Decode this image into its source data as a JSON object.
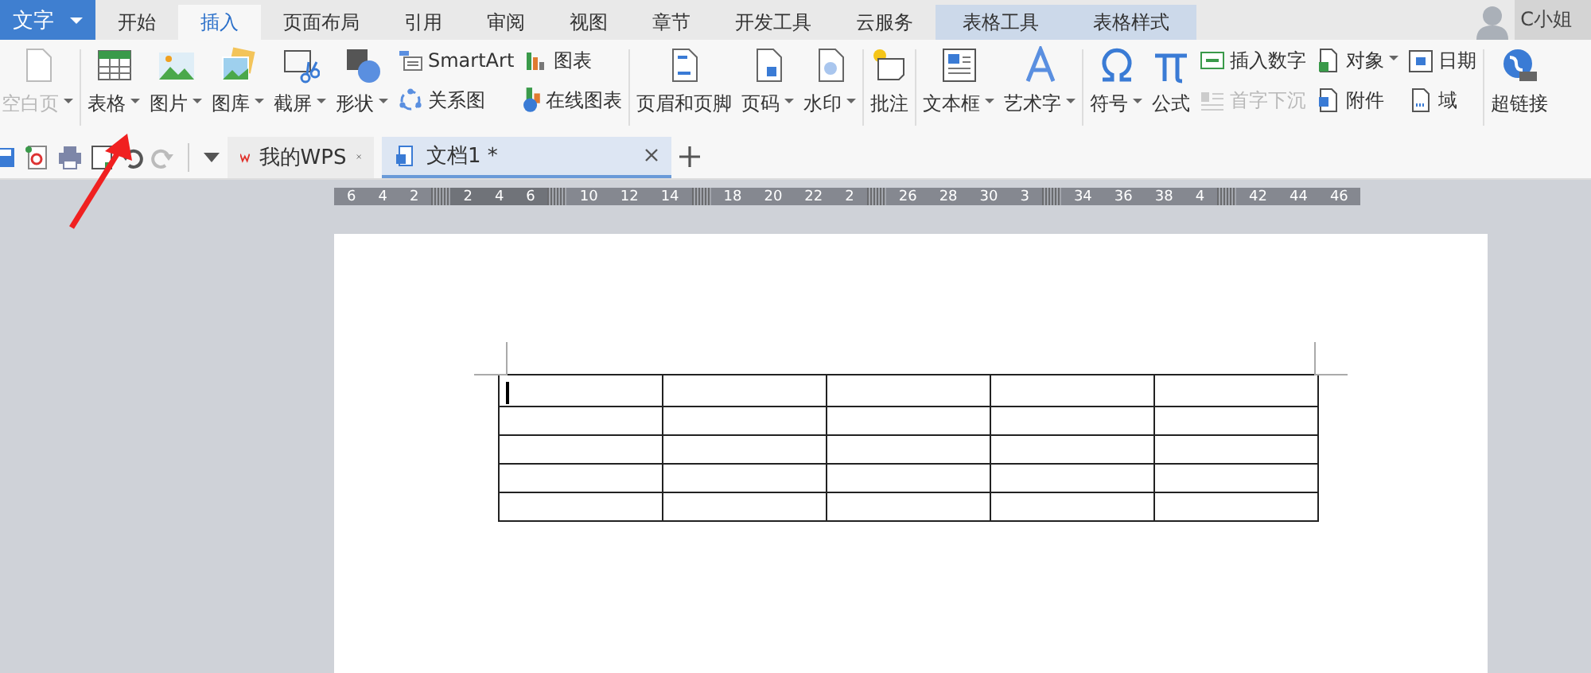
{
  "app_button": {
    "label": "文字"
  },
  "tabs": [
    {
      "label": "开始",
      "selected": false,
      "contextual": false
    },
    {
      "label": "插入",
      "selected": true,
      "contextual": false
    },
    {
      "label": "页面布局",
      "selected": false,
      "contextual": false
    },
    {
      "label": "引用",
      "selected": false,
      "contextual": false
    },
    {
      "label": "审阅",
      "selected": false,
      "contextual": false
    },
    {
      "label": "视图",
      "selected": false,
      "contextual": false
    },
    {
      "label": "章节",
      "selected": false,
      "contextual": false
    },
    {
      "label": "开发工具",
      "selected": false,
      "contextual": false
    },
    {
      "label": "云服务",
      "selected": false,
      "contextual": false
    },
    {
      "label": "表格工具",
      "selected": false,
      "contextual": true
    },
    {
      "label": "表格样式",
      "selected": false,
      "contextual": true
    }
  ],
  "user": {
    "name": "C小姐"
  },
  "ribbon_groups": [
    {
      "items": [
        {
          "kind": "large",
          "label": "空白页",
          "dropdown": true,
          "disabled": true
        }
      ]
    },
    {
      "items": [
        {
          "kind": "large",
          "label": "表格",
          "dropdown": true,
          "disabled": false
        },
        {
          "kind": "large",
          "label": "图片",
          "dropdown": true,
          "disabled": false
        },
        {
          "kind": "large",
          "label": "图库",
          "dropdown": true,
          "disabled": false
        },
        {
          "kind": "large",
          "label": "截屏",
          "dropdown": true,
          "disabled": false
        },
        {
          "kind": "large",
          "label": "形状",
          "dropdown": true,
          "disabled": false
        },
        {
          "kind": "stack",
          "entries": [
            {
              "label": "SmartArt",
              "dropdown": false,
              "disabled": false
            },
            {
              "label": "关系图",
              "dropdown": false,
              "disabled": false
            }
          ]
        },
        {
          "kind": "stack",
          "entries": [
            {
              "label": "图表",
              "dropdown": false,
              "disabled": false
            },
            {
              "label": "在线图表",
              "dropdown": false,
              "disabled": false
            }
          ]
        }
      ]
    },
    {
      "items": [
        {
          "kind": "large",
          "label": "页眉和页脚",
          "dropdown": false,
          "disabled": false
        },
        {
          "kind": "large",
          "label": "页码",
          "dropdown": true,
          "disabled": false
        },
        {
          "kind": "large",
          "label": "水印",
          "dropdown": true,
          "disabled": false
        }
      ]
    },
    {
      "items": [
        {
          "kind": "large",
          "label": "批注",
          "dropdown": false,
          "disabled": false
        }
      ]
    },
    {
      "items": [
        {
          "kind": "large",
          "label": "文本框",
          "dropdown": true,
          "disabled": false
        },
        {
          "kind": "large",
          "label": "艺术字",
          "dropdown": true,
          "disabled": false
        }
      ]
    },
    {
      "items": [
        {
          "kind": "large",
          "label": "符号",
          "dropdown": true,
          "disabled": false
        },
        {
          "kind": "large",
          "label": "公式",
          "dropdown": false,
          "disabled": false
        },
        {
          "kind": "stack",
          "entries": [
            {
              "label": "插入数字",
              "dropdown": false,
              "disabled": false
            },
            {
              "label": "首字下沉",
              "dropdown": false,
              "disabled": true
            }
          ]
        },
        {
          "kind": "stack",
          "entries": [
            {
              "label": "对象",
              "dropdown": true,
              "disabled": false
            },
            {
              "label": "附件",
              "dropdown": false,
              "disabled": false
            }
          ]
        },
        {
          "kind": "stack",
          "entries": [
            {
              "label": "日期",
              "dropdown": false,
              "disabled": false
            },
            {
              "label": "域",
              "dropdown": false,
              "disabled": false
            }
          ]
        }
      ]
    },
    {
      "items": [
        {
          "kind": "large",
          "label": "超链接",
          "dropdown": false,
          "disabled": false
        }
      ]
    }
  ],
  "doc_tabs": [
    {
      "label": "我的WPS",
      "selected": false
    },
    {
      "label": "文档1 *",
      "selected": true
    }
  ],
  "ruler": {
    "segments": [
      [
        "6",
        "4",
        "2"
      ],
      [
        "2",
        "4",
        "6"
      ],
      [
        "10",
        "12",
        "14"
      ],
      [
        "18",
        "20",
        "22",
        "2"
      ],
      [
        "26",
        "28",
        "30",
        "3"
      ],
      [
        "34",
        "36",
        "38",
        "4"
      ],
      [
        "42",
        "44",
        "46"
      ]
    ]
  },
  "table": {
    "rows": [
      {
        "cells": [
          {
            "cursor": true
          },
          {
            "cursor": false
          },
          {
            "cursor": false
          },
          {
            "cursor": false
          },
          {
            "cursor": false
          }
        ]
      },
      {
        "cells": [
          {
            "cursor": false
          },
          {
            "cursor": false
          },
          {
            "cursor": false
          },
          {
            "cursor": false
          },
          {
            "cursor": false
          }
        ]
      },
      {
        "cells": [
          {
            "cursor": false
          },
          {
            "cursor": false
          },
          {
            "cursor": false
          },
          {
            "cursor": false
          },
          {
            "cursor": false
          }
        ]
      },
      {
        "cells": [
          {
            "cursor": false
          },
          {
            "cursor": false
          },
          {
            "cursor": false
          },
          {
            "cursor": false
          },
          {
            "cursor": false
          }
        ]
      },
      {
        "cells": [
          {
            "cursor": false
          },
          {
            "cursor": false
          },
          {
            "cursor": false
          },
          {
            "cursor": false
          },
          {
            "cursor": false
          }
        ]
      }
    ]
  }
}
